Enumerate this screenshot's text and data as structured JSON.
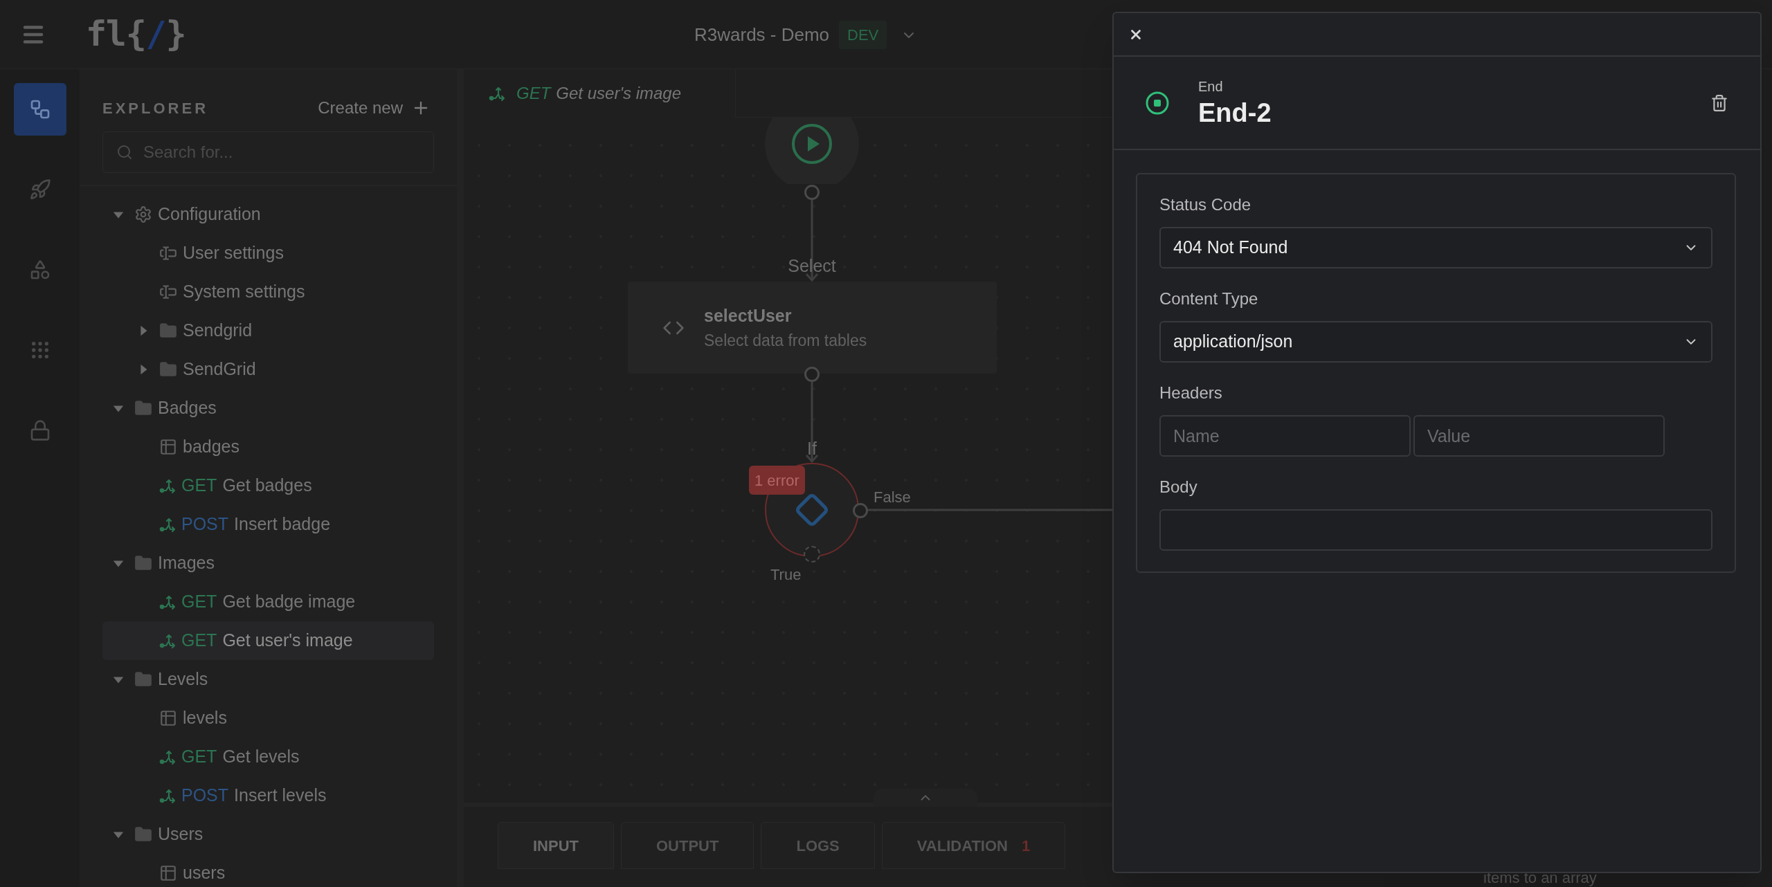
{
  "app_bar": {
    "logo": [
      {
        "text": "fl{",
        "accent": false
      },
      {
        "text": "/",
        "accent": true
      },
      {
        "text": "}",
        "accent": false
      }
    ],
    "project": "R3wards - Demo",
    "environment": "DEV"
  },
  "nav_rail": [
    {
      "kind": "flow",
      "selected": true
    },
    {
      "kind": "deploy",
      "selected": false
    },
    {
      "kind": "widgets",
      "selected": false
    },
    {
      "kind": "apps",
      "selected": false
    },
    {
      "kind": "lock",
      "selected": false
    }
  ],
  "explorer": {
    "title": "EXPLORER",
    "create_label": "Create new",
    "search_placeholder": "Search for...",
    "tree": [
      {
        "kind": "config",
        "label": "Configuration",
        "expanded": true,
        "selected": false,
        "children": [
          {
            "kind": "setting",
            "label": "User settings",
            "selected": false
          },
          {
            "kind": "setting",
            "label": "System settings",
            "selected": false
          },
          {
            "kind": "folder",
            "label": "Sendgrid",
            "expanded": false,
            "selected": false
          },
          {
            "kind": "folder",
            "label": "SendGrid",
            "expanded": false,
            "selected": false
          }
        ]
      },
      {
        "kind": "folder",
        "label": "Badges",
        "expanded": true,
        "selected": false,
        "children": [
          {
            "kind": "table",
            "label": "badges",
            "selected": false
          },
          {
            "kind": "endpoint",
            "method": "GET",
            "label": "Get badges",
            "selected": false
          },
          {
            "kind": "endpoint",
            "method": "POST",
            "label": "Insert badge",
            "selected": false
          }
        ]
      },
      {
        "kind": "folder",
        "label": "Images",
        "expanded": true,
        "selected": false,
        "children": [
          {
            "kind": "endpoint",
            "method": "GET",
            "label": "Get badge image",
            "selected": false
          },
          {
            "kind": "endpoint",
            "method": "GET",
            "label": "Get user's image",
            "selected": true
          }
        ]
      },
      {
        "kind": "folder",
        "label": "Levels",
        "expanded": true,
        "selected": false,
        "children": [
          {
            "kind": "table",
            "label": "levels",
            "selected": false
          },
          {
            "kind": "endpoint",
            "method": "GET",
            "label": "Get levels",
            "selected": false
          },
          {
            "kind": "endpoint",
            "method": "POST",
            "label": "Insert levels",
            "selected": false
          }
        ]
      },
      {
        "kind": "folder",
        "label": "Users",
        "expanded": true,
        "selected": false,
        "children": [
          {
            "kind": "table",
            "label": "users",
            "selected": false
          }
        ]
      }
    ]
  },
  "editor_tab": {
    "method": "GET",
    "title": "Get user's image"
  },
  "canvas": {
    "nodes": [
      {
        "kind": "start"
      },
      {
        "kind": "function",
        "label": "Select",
        "title": "selectUser",
        "subtitle": "Select data from tables"
      },
      {
        "kind": "condition",
        "label": "If",
        "error": "1 error",
        "false_label": "False",
        "true_label": "True"
      }
    ]
  },
  "bottom_tabs": [
    {
      "label": "INPUT",
      "selected": true
    },
    {
      "label": "OUTPUT",
      "selected": false
    },
    {
      "label": "LOGS",
      "selected": false
    },
    {
      "label": "VALIDATION",
      "count": "1",
      "selected": false
    }
  ],
  "side_text": "items to an array",
  "dialog": {
    "node_type": "End",
    "node_name": "End-2",
    "fields": [
      {
        "kind": "select",
        "label": "Status Code",
        "value": "404 Not Found"
      },
      {
        "kind": "select",
        "label": "Content Type",
        "value": "application/json"
      },
      {
        "kind": "pair",
        "label": "Headers",
        "placeholders": [
          "Name",
          "Value"
        ]
      },
      {
        "kind": "textarea",
        "label": "Body"
      }
    ]
  }
}
